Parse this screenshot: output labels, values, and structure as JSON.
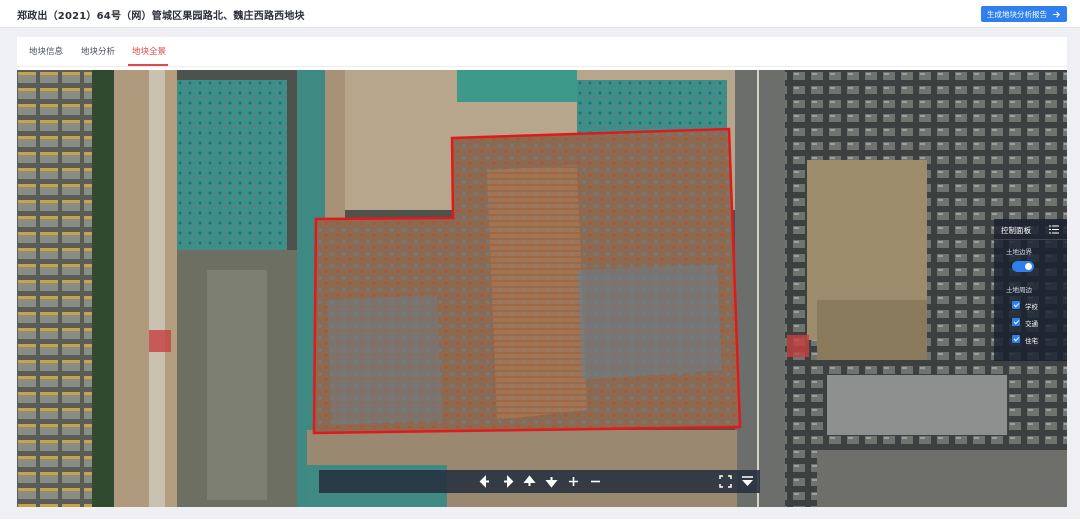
{
  "header": {
    "title": "郑政出（2021）64号（网）管城区果园路北、魏庄西路西地块",
    "report_button": "生成地块分析报告"
  },
  "tabs": [
    {
      "label": "地块信息",
      "active": false
    },
    {
      "label": "地块分析",
      "active": false
    },
    {
      "label": "地块全景",
      "active": true
    }
  ],
  "map": {
    "boundary_color": "#e0191c"
  },
  "control_panel": {
    "title": "控制面板",
    "boundary_label": "土地边界",
    "boundary_on": true,
    "surroundings_label": "土地周边",
    "options": [
      {
        "label": "学校",
        "checked": true
      },
      {
        "label": "交通",
        "checked": true
      },
      {
        "label": "住宅",
        "checked": true
      }
    ]
  },
  "toolbar": {
    "buttons": [
      "arrow-left-icon",
      "arrow-right-icon",
      "arrow-up-icon",
      "arrow-down-icon",
      "zoom-in-icon",
      "zoom-out-icon",
      "fullscreen-icon",
      "layers-down-icon"
    ]
  },
  "colors": {
    "accent": "#2f80ed",
    "active_tab": "#e0484c"
  }
}
